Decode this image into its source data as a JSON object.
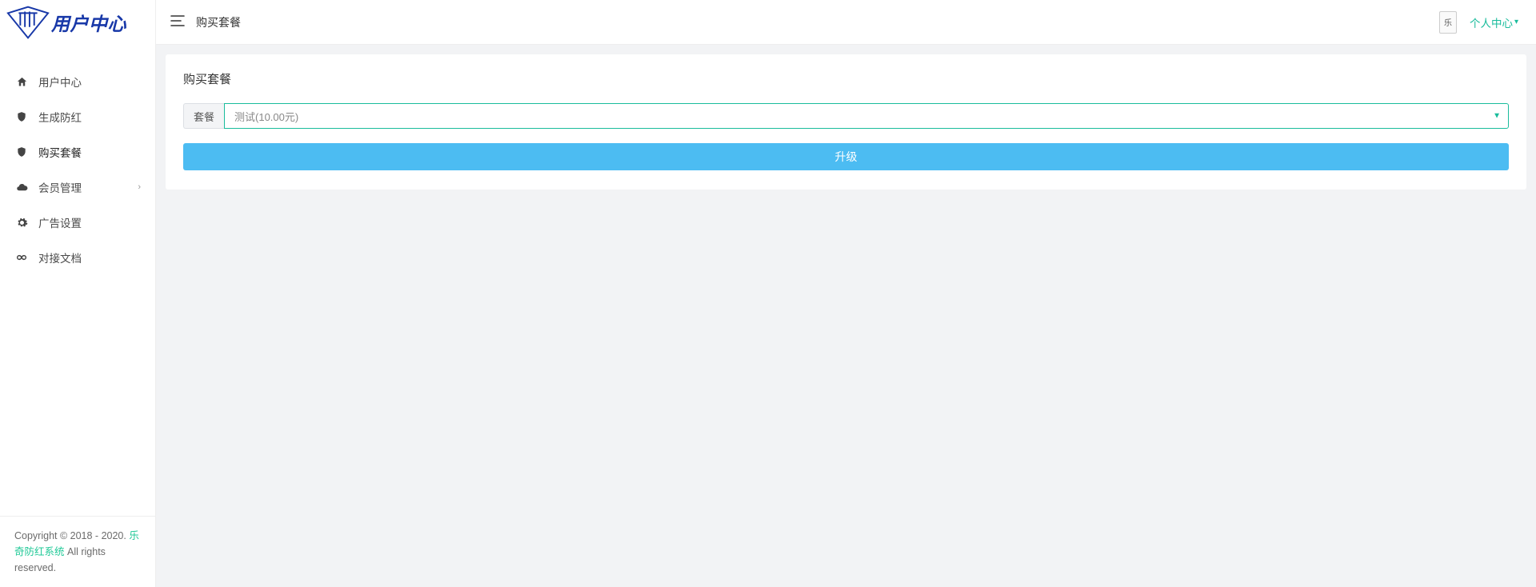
{
  "brand": {
    "name": "用户中心"
  },
  "topbar": {
    "page_title": "购买套餐",
    "user_dropdown_label": "个人中心"
  },
  "sidebar": {
    "items": [
      {
        "label": "用户中心",
        "icon": "home"
      },
      {
        "label": "生成防红",
        "icon": "shield"
      },
      {
        "label": "购买套餐",
        "icon": "shield-fill"
      },
      {
        "label": "会员管理",
        "icon": "cloud",
        "has_children": true
      },
      {
        "label": "广告设置",
        "icon": "gear"
      },
      {
        "label": "对接文档",
        "icon": "infinity"
      }
    ]
  },
  "card": {
    "title": "购买套餐",
    "addon_label": "套餐",
    "select_value": "测试(10.00元)",
    "upgrade_label": "升级"
  },
  "footer": {
    "prefix": "Copyright © 2018 - 2020. ",
    "link": "乐奇防红系统",
    "suffix": " All rights reserved."
  }
}
